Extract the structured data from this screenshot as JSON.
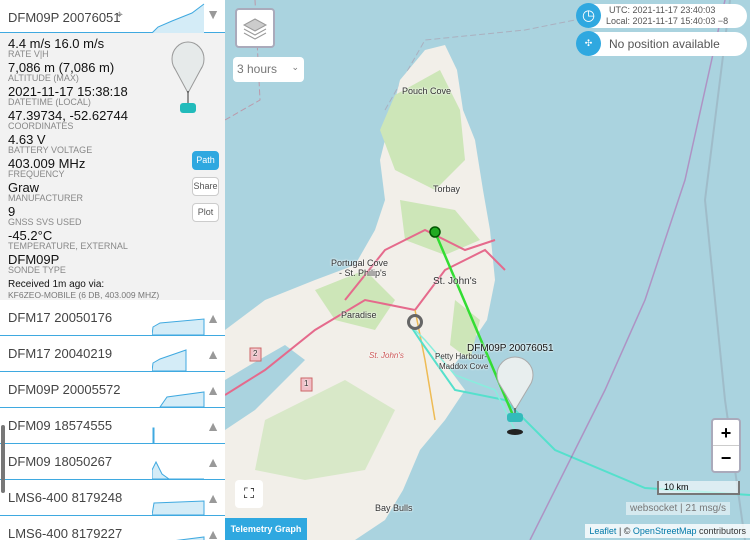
{
  "selected": {
    "title": "DFM09P 20076051",
    "fields": [
      {
        "value": "4.4 m/s 16.0 m/s",
        "label": "RATE V|H"
      },
      {
        "value": "7,086 m (7,086 m)",
        "label": "ALTITUDE (MAX)"
      },
      {
        "value": "2021-11-17 15:38:18",
        "label": "DATETIME (LOCAL)"
      },
      {
        "value": "47.39734, -52.62744",
        "label": "COORDINATES"
      },
      {
        "value": "4.63 V",
        "label": "BATTERY VOLTAGE"
      },
      {
        "value": "403.009 MHz",
        "label": "FREQUENCY"
      },
      {
        "value": "Graw",
        "label": "MANUFACTURER"
      },
      {
        "value": "9",
        "label": "GNSS SVS USED"
      },
      {
        "value": "-45.2°C",
        "label": "TEMPERATURE, EXTERNAL"
      },
      {
        "value": "DFM09P",
        "label": "SONDE TYPE"
      }
    ],
    "received": "Received 1m ago via:",
    "receiver": "KF6ZEO-MOBILE (6 DB, 403.009 MHZ)",
    "buttons": {
      "path": "Path",
      "share": "Share",
      "plot": "Plot"
    }
  },
  "sondes": [
    {
      "name": "DFM17 20050176"
    },
    {
      "name": "DFM17 20040219"
    },
    {
      "name": "DFM09P 20005572"
    },
    {
      "name": "DFM09 18574555"
    },
    {
      "name": "DFM09 18050267"
    },
    {
      "name": "LMS6-400 8179248"
    },
    {
      "name": "LMS6-400 8179227"
    }
  ],
  "map": {
    "time_select": "3 hours",
    "utc": "UTC: 2021-11-17 23:40:03",
    "local": "Local: 2021-11-17 15:40:03 −8",
    "position": "No position available",
    "labels": {
      "pouch": "Pouch Cove",
      "torbay": "Torbay",
      "portugal": "Portugal Cove",
      "stphilips": "- St. Philip's",
      "stjohns": "St. John's",
      "paradise": "Paradise",
      "stjohns2": "St. John's",
      "petty": "Petty Harbour-",
      "maddox": "Maddox Cove",
      "baybulls": "Bay Bulls",
      "sonde": "DFM09P 20076051",
      "r1": "1",
      "r2": "2"
    },
    "scale": "10 km",
    "status": "websocket | 21 msg/s",
    "attr_leaflet": "Leaflet",
    "attr_sep": " | © ",
    "attr_osm": "OpenStreetMap",
    "attr_contrib": " contributors",
    "telemetry": "Telemetry Graph",
    "zoom_in": "+",
    "zoom_out": "−"
  },
  "colors": {
    "accent": "#2fa8e0",
    "path": "#33dd33",
    "track": "#55e0cc"
  }
}
